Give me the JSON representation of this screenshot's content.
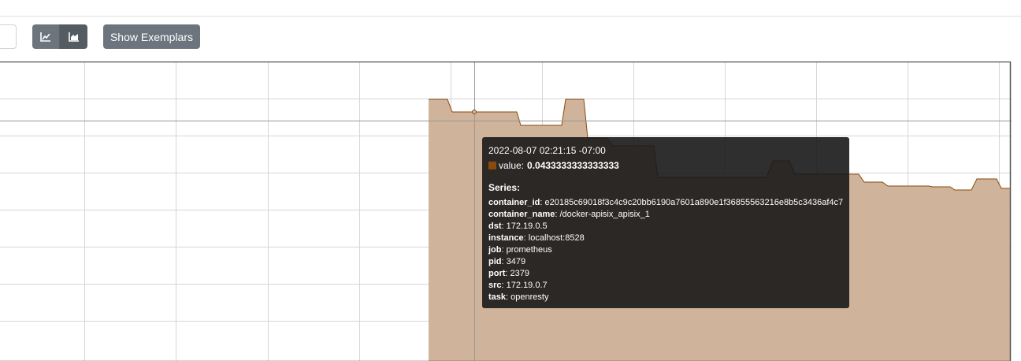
{
  "toolbar": {
    "line_icon": "line-chart-icon",
    "stacked_icon": "stacked-area-chart-icon",
    "exemplars_label": "Show Exemplars"
  },
  "colors": {
    "area_fill": "#cfb39a",
    "area_stroke": "#8a4a0e",
    "tooltip_bg": "#181818",
    "button": "#6c757d"
  },
  "tooltip": {
    "time": "2022-08-07 02:21:15 -07:00",
    "value_label": "value:",
    "value": "0.0433333333333333",
    "series_heading": "Series:",
    "labels": [
      {
        "key": "container_id",
        "value": "e20185c69018f3c4c9c20bb6190a7601a890e1f36855563216e8b5c3436af4c7"
      },
      {
        "key": "container_name",
        "value": "/docker-apisix_apisix_1"
      },
      {
        "key": "dst",
        "value": "172.19.0.5"
      },
      {
        "key": "instance",
        "value": "localhost:8528"
      },
      {
        "key": "job",
        "value": "prometheus"
      },
      {
        "key": "pid",
        "value": "3479"
      },
      {
        "key": "port",
        "value": "2379"
      },
      {
        "key": "src",
        "value": "172.19.0.7"
      },
      {
        "key": "task",
        "value": "openresty"
      }
    ]
  }
}
